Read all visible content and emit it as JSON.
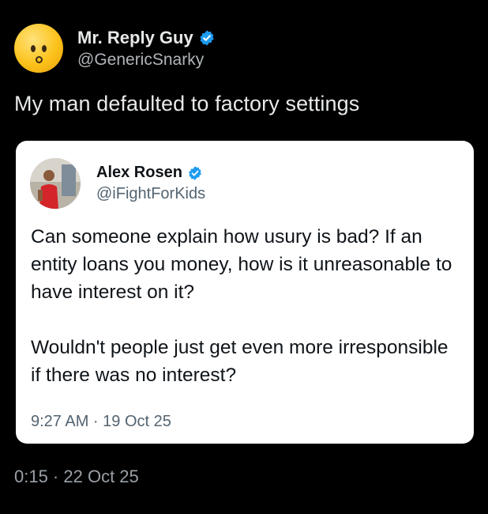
{
  "tweet": {
    "author": {
      "display_name": "Mr. Reply Guy",
      "handle": "@GenericSnarky",
      "avatar": "upside-down-face-emoji",
      "verified": true
    },
    "text": "My man defaulted to factory settings",
    "timestamp": "0:15 · 22 Oct 25"
  },
  "quoted_tweet": {
    "author": {
      "display_name": "Alex Rosen",
      "handle": "@iFightForKids",
      "verified": true
    },
    "text_paragraph_1": "Can someone explain how usury is bad? If an entity loans you money, how is it unreasonable to have interest on it?",
    "text_paragraph_2": "Wouldn't people just get even more irresponsible if there was no interest?",
    "timestamp": "9:27 AM · 19 Oct 25"
  },
  "colors": {
    "background": "#000000",
    "text_primary": "#e7e9ea",
    "verified_blue": "#1d9bf0",
    "card_background": "#ffffff"
  }
}
